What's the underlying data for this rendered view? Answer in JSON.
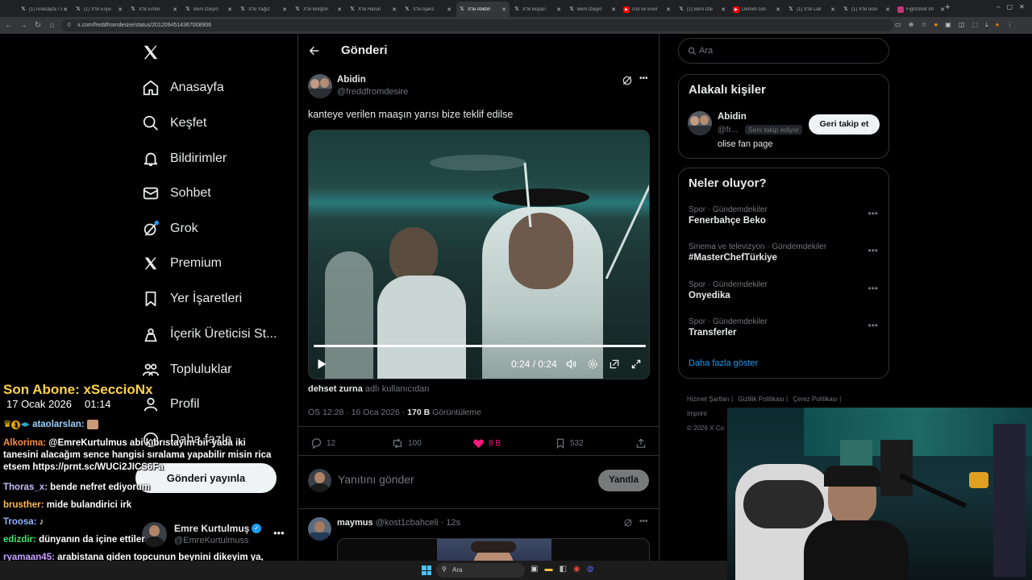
{
  "browser": {
    "tabs": [
      {
        "title": "(1) Anasayfa / X",
        "icon": "x-icon"
      },
      {
        "title": "(1) X'te Enjiv",
        "icon": "x-icon"
      },
      {
        "title": "X'te Emre",
        "icon": "x-icon"
      },
      {
        "title": "Beni İzleyin",
        "icon": "x-icon"
      },
      {
        "title": "X'te Yağız",
        "icon": "x-icon"
      },
      {
        "title": "X'te Burğon",
        "icon": "x-icon"
      },
      {
        "title": "X'te Harun",
        "icon": "x-icon"
      },
      {
        "title": "X'te Ajans",
        "icon": "x-icon"
      },
      {
        "title": "X'te Abidin",
        "icon": "x-icon",
        "active": true
      },
      {
        "title": "X'te Boyarı",
        "icon": "x-icon"
      },
      {
        "title": "Beni İzleyin",
        "icon": "x-icon"
      },
      {
        "title": "Gol ve Ener",
        "icon": "youtube-icon"
      },
      {
        "title": "(1) Beni İzle",
        "icon": "x-icon"
      },
      {
        "title": "Demirli Göl",
        "icon": "youtube-icon"
      },
      {
        "title": "(1) X'te Lali",
        "icon": "x-icon"
      },
      {
        "title": "(1) X'te İkon",
        "icon": "x-icon"
      },
      {
        "title": "FightShot İnt",
        "icon": "fight-icon"
      }
    ],
    "url": "x.com/freddfromdesire/status/2012094514367008906"
  },
  "sidebar": {
    "items": [
      {
        "label": "Anasayfa",
        "icon": "home-icon"
      },
      {
        "label": "Keşfet",
        "icon": "search-icon"
      },
      {
        "label": "Bildirimler",
        "icon": "bell-icon"
      },
      {
        "label": "Sohbet",
        "icon": "mail-icon"
      },
      {
        "label": "Grok",
        "icon": "grok-icon"
      },
      {
        "label": "Premium",
        "icon": "x-premium-icon"
      },
      {
        "label": "Yer İşaretleri",
        "icon": "bookmark-icon"
      },
      {
        "label": "İçerik Üreticisi St...",
        "icon": "creator-icon"
      },
      {
        "label": "Topluluklar",
        "icon": "communities-icon"
      },
      {
        "label": "Profil",
        "icon": "profile-icon"
      },
      {
        "label": "Daha fazla",
        "icon": "more-icon"
      }
    ],
    "post_button": "Gönderi yayınla",
    "account": {
      "name": "Emre Kurtulmuş",
      "handle": "@EmreKurtulmuss"
    }
  },
  "stream_overlay": {
    "last_sub": "Son Abone: xSeccioNx",
    "date": "17 Ocak 2026",
    "time": "01:14",
    "chat": [
      {
        "user": "ataolarslan:",
        "text": "",
        "badge": true
      },
      {
        "user": "Alkorima:",
        "text": "@EmreKurtulmus abi kıbrıstayım bir yada iki tanesini alacağım sence hangisi sıralama yapabilir misin rica etsem https://prnt.sc/WUCi2JICS6Fa"
      },
      {
        "user": "Thoras_x:",
        "text": "bende nefret ediyorum"
      },
      {
        "user": "brusther:",
        "text": "mide bulandirici irk"
      },
      {
        "user": "Troosa:",
        "text": ""
      },
      {
        "user": "edizdir:",
        "text": "dünyanın da içine ettiler"
      },
      {
        "user": "ryamaan45:",
        "text": "arabistana giden topcunun beynini dikeyim ya, kendini saygısını olan adam araçlara mi gider aq"
      }
    ]
  },
  "main": {
    "header_title": "Gönderi",
    "post": {
      "author_name": "Abidin",
      "author_handle": "@freddfromdesire",
      "text": "kanteye verilen maaşın yarısı bize teklif edilse",
      "video": {
        "current": "0:24",
        "duration": "0:24",
        "time_display": "0:24 / 0:24",
        "progress": 1.0
      },
      "credit_name": "dehset zurna",
      "credit_suffix": "adlı kullanıcıdan",
      "timestamp": "ÖS 12:28 · 16 Oca 2026 ·",
      "views_count": "170 B",
      "views_label": "Görüntüleme",
      "replies": "12",
      "reposts": "100",
      "likes": "8 B",
      "bookmarks": "532"
    },
    "reply_box": {
      "placeholder": "Yanıtını gönder",
      "button": "Yanıtla"
    },
    "next_reply": {
      "name": "maymus",
      "handle": "@kost1cbahceli",
      "time": "· 12s"
    }
  },
  "right": {
    "search_placeholder": "Ara",
    "relevant": {
      "title": "Alakalı kişiler",
      "name": "Abidin",
      "handle": "@fr...",
      "follows_you": "Seni takip ediyor",
      "button": "Geri takip et",
      "bio": "olise fan page"
    },
    "trends": {
      "title": "Neler oluyor?",
      "items": [
        {
          "meta": "Spor · Gündemdekiler",
          "name": "Fenerbahçe Beko"
        },
        {
          "meta": "Sinema ve televizyon · Gündemdekiler",
          "name": "#MasterChefTürkiye"
        },
        {
          "meta": "Spor · Gündemdekiler",
          "name": "Onyedika"
        },
        {
          "meta": "Spor · Gündemdekiler",
          "name": "Transferler"
        }
      ],
      "show_more": "Daha fazla göster"
    },
    "footer": {
      "links": [
        "Hizmet Şartları",
        "Gizlilik Politikası",
        "Çerez Politikası",
        "Imprint"
      ],
      "copyright": "© 2026 X Co"
    }
  },
  "taskbar": {
    "search": "Ara"
  },
  "colors": {
    "accent": "#1d9bf0",
    "like": "#f91880",
    "bg": "#000000",
    "border": "#2f3336"
  }
}
